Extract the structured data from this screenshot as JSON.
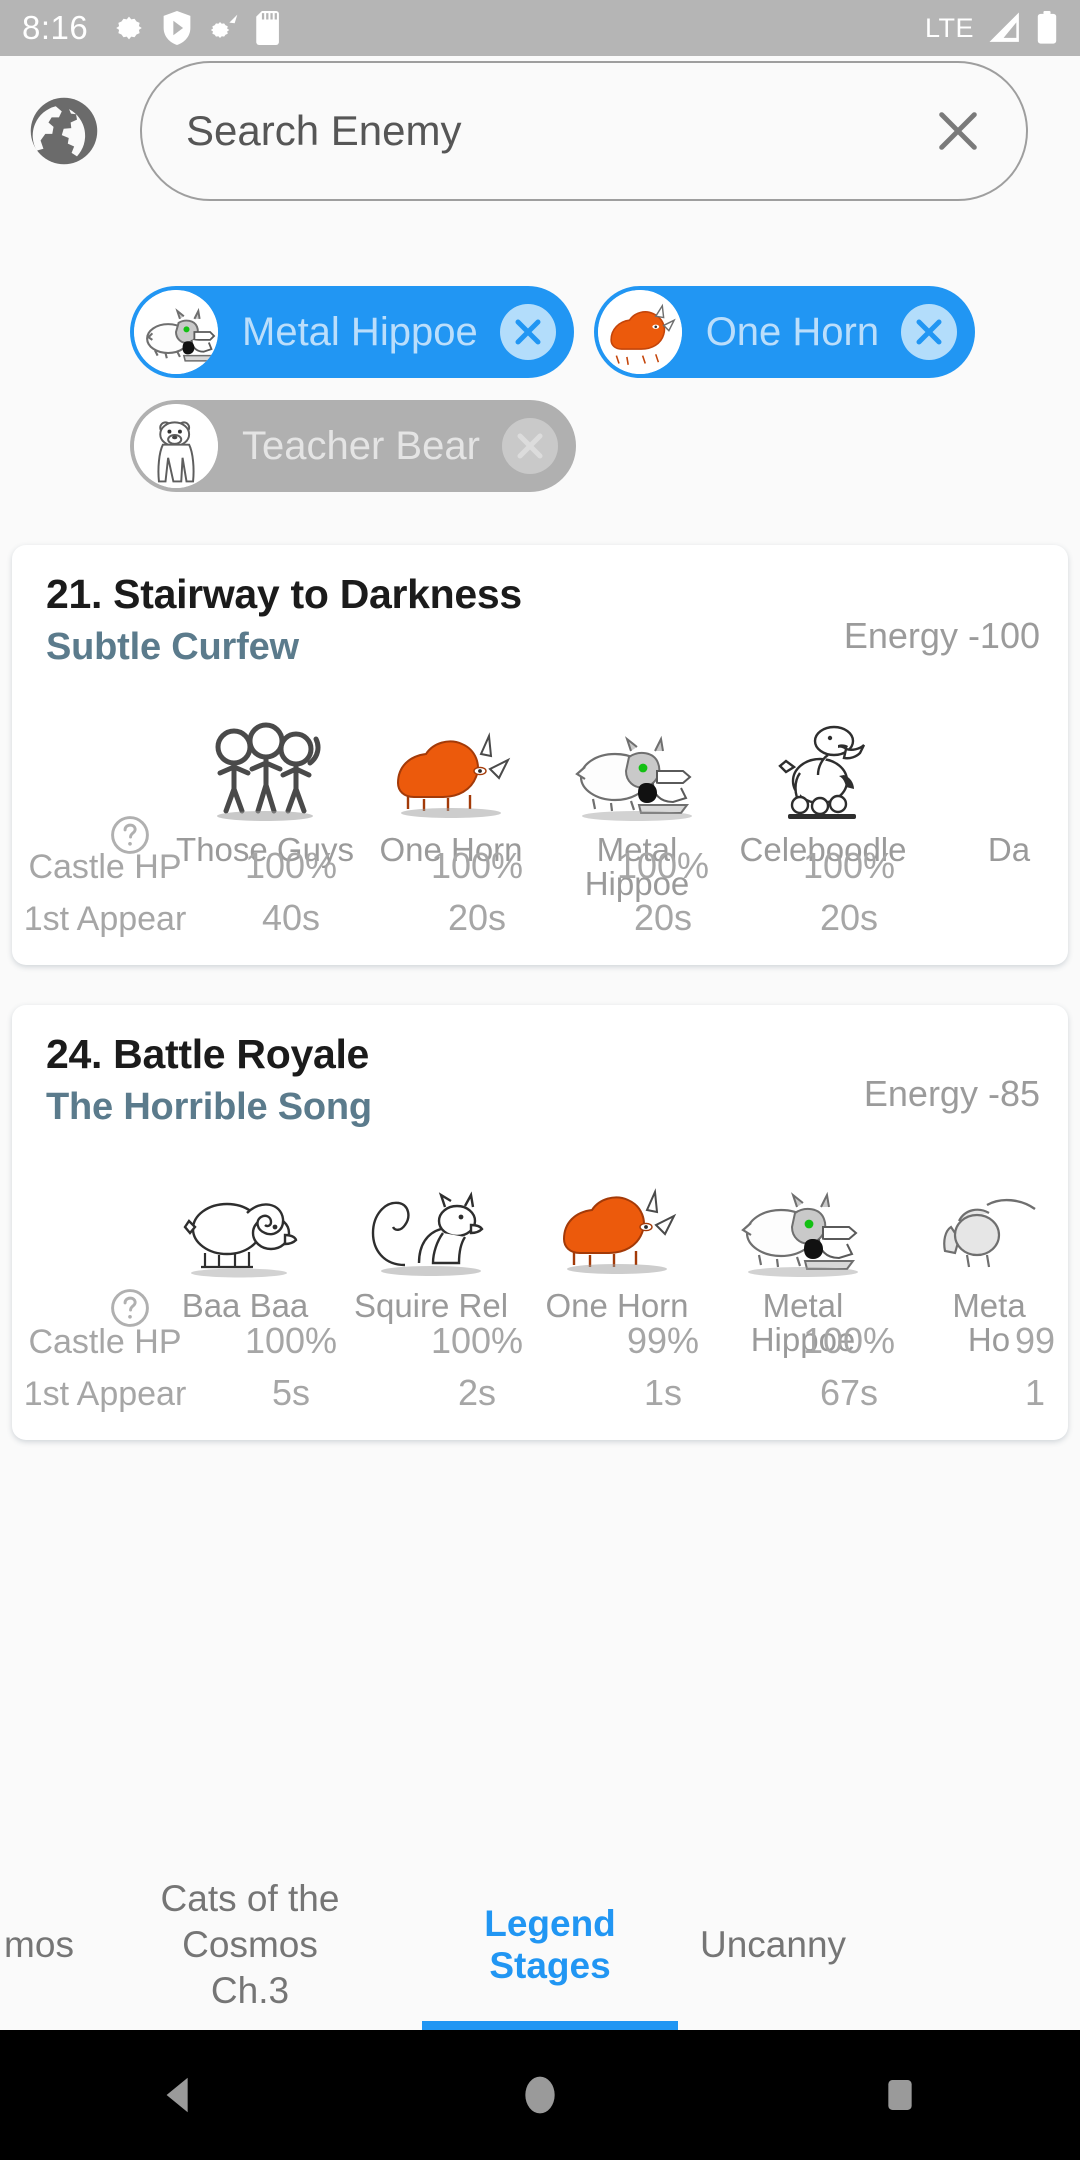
{
  "status_bar": {
    "time": "8:16",
    "left_icons": [
      "gear-icon",
      "shield-play-icon",
      "settings-beam-icon",
      "sd-card-icon"
    ],
    "network": "LTE",
    "right_icons": [
      "signal-icon",
      "battery-icon"
    ]
  },
  "search": {
    "globe_icon": "globe-icon",
    "placeholder": "Search Enemy",
    "value": "",
    "clear_icon": "close-icon"
  },
  "filter_chips": [
    {
      "label": "Metal Hippoe",
      "active": true,
      "avatar": "metal-hippoe",
      "remove_icon": "close-circle-icon"
    },
    {
      "label": "One Horn",
      "active": true,
      "avatar": "one-horn",
      "remove_icon": "close-circle-icon"
    },
    {
      "label": "Teacher Bear",
      "active": false,
      "avatar": "teacher-bear",
      "remove_icon": "close-circle-icon"
    }
  ],
  "colors": {
    "accent": "#2196f3",
    "chip_active": "#2196f3",
    "chip_inactive": "#b0b0b0",
    "subtitle": "#5b7b8c",
    "muted": "#9a9a9a",
    "status_bar": "#b5b5b5",
    "page_bg": "#fafafa"
  },
  "stats_labels": {
    "castle_hp": "Castle HP",
    "first_appear": "1st Appear",
    "help_icon": "help-circle-icon"
  },
  "stages": [
    {
      "number_title": "21. Stairway to Darkness",
      "subtitle": "Subtle Curfew",
      "energy": "Energy -100",
      "enemies": [
        {
          "name": "Those Guys",
          "sprite": "those-guys",
          "castle_hp": "100%",
          "first_appear": "40s"
        },
        {
          "name": "One Horn",
          "sprite": "one-horn",
          "castle_hp": "100%",
          "first_appear": "20s"
        },
        {
          "name": "Metal Hippoe",
          "sprite": "metal-hippoe",
          "castle_hp": "100%",
          "first_appear": "20s"
        },
        {
          "name": "Celeboodle",
          "sprite": "celeboodle",
          "castle_hp": "100%",
          "first_appear": "20s"
        },
        {
          "name": "Da",
          "sprite": "cutoff",
          "castle_hp": "",
          "first_appear": ""
        }
      ]
    },
    {
      "number_title": "24. Battle Royale",
      "subtitle": "The Horrible Song",
      "energy": "Energy -85",
      "enemies": [
        {
          "name": "Baa Baa",
          "sprite": "baa-baa",
          "castle_hp": "100%",
          "first_appear": "5s"
        },
        {
          "name": "Squire Rel",
          "sprite": "squire-rel",
          "castle_hp": "100%",
          "first_appear": "2s"
        },
        {
          "name": "One Horn",
          "sprite": "one-horn",
          "castle_hp": "99%",
          "first_appear": "1s"
        },
        {
          "name": "Metal Hippoe",
          "sprite": "metal-hippoe",
          "castle_hp": "100%",
          "first_appear": "67s"
        },
        {
          "name": "Meta\nHo",
          "sprite": "metal-cutoff",
          "castle_hp": "99",
          "first_appear": "1"
        }
      ]
    }
  ],
  "tabs": [
    {
      "label": "mos",
      "active": false
    },
    {
      "label": "Cats of the Cosmos\nCh.3",
      "active": false
    },
    {
      "label": "Legend Stages",
      "active": true
    },
    {
      "label": "Uncanny",
      "active": false
    }
  ],
  "nav_bar": {
    "back": "back-triangle-icon",
    "home": "home-circle-icon",
    "recents": "recents-square-icon"
  }
}
